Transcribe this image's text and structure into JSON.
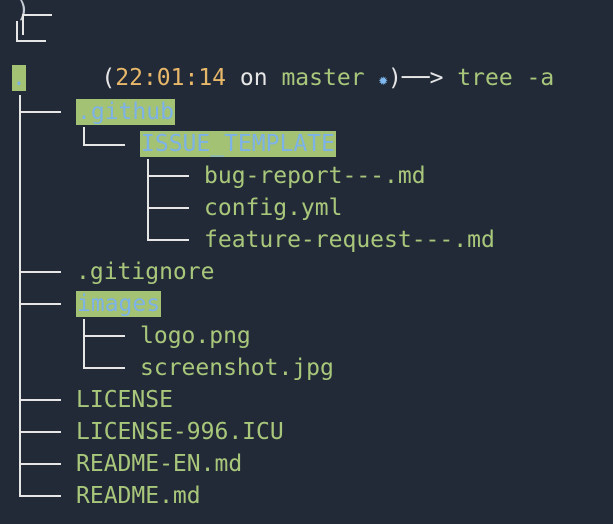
{
  "prompt": {
    "top_glyph": ")",
    "open_paren": "(",
    "time": "22:01:14",
    "on_text": "on",
    "branch": "master",
    "star_symbol": "✹",
    "arrow": ")──>",
    "command": "tree -a"
  },
  "tree": {
    "root": ".",
    "items": [
      ".github",
      "ISSUE_TEMPLATE",
      "bug-report---.md",
      "config.yml",
      "feature-request---.md",
      ".gitignore",
      "images",
      "logo.png",
      "screenshot.jpg",
      "LICENSE",
      "LICENSE-996.ICU",
      "README-EN.md",
      "README.md"
    ]
  },
  "colors": {
    "background": "#222a37",
    "file_text": "#a9c77b",
    "directory_text": "#7db2e8",
    "directory_highlight": "#a3c273",
    "time": "#e8b86a",
    "tree_lines": "#e6e6e6"
  }
}
